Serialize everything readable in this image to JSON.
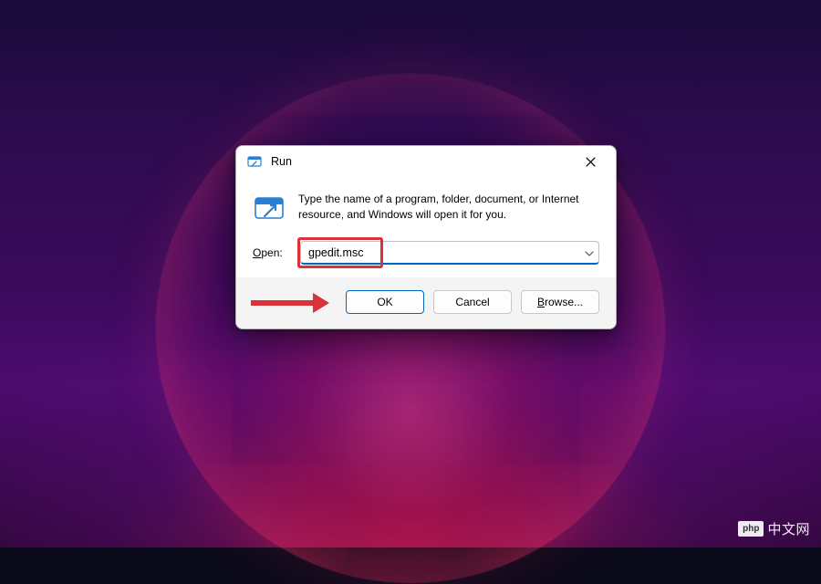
{
  "dialog": {
    "title": "Run",
    "description": "Type the name of a program, folder, document, or Internet resource, and Windows will open it for you.",
    "open_label_prefix": "O",
    "open_label_rest": "pen:",
    "input_value": "gpedit.msc",
    "buttons": {
      "ok": "OK",
      "cancel": "Cancel",
      "browse_prefix": "B",
      "browse_rest": "rowse..."
    }
  },
  "watermark": {
    "badge": "php",
    "text": "中文网"
  },
  "colors": {
    "accent": "#0067c0",
    "highlight": "#d9323a"
  }
}
